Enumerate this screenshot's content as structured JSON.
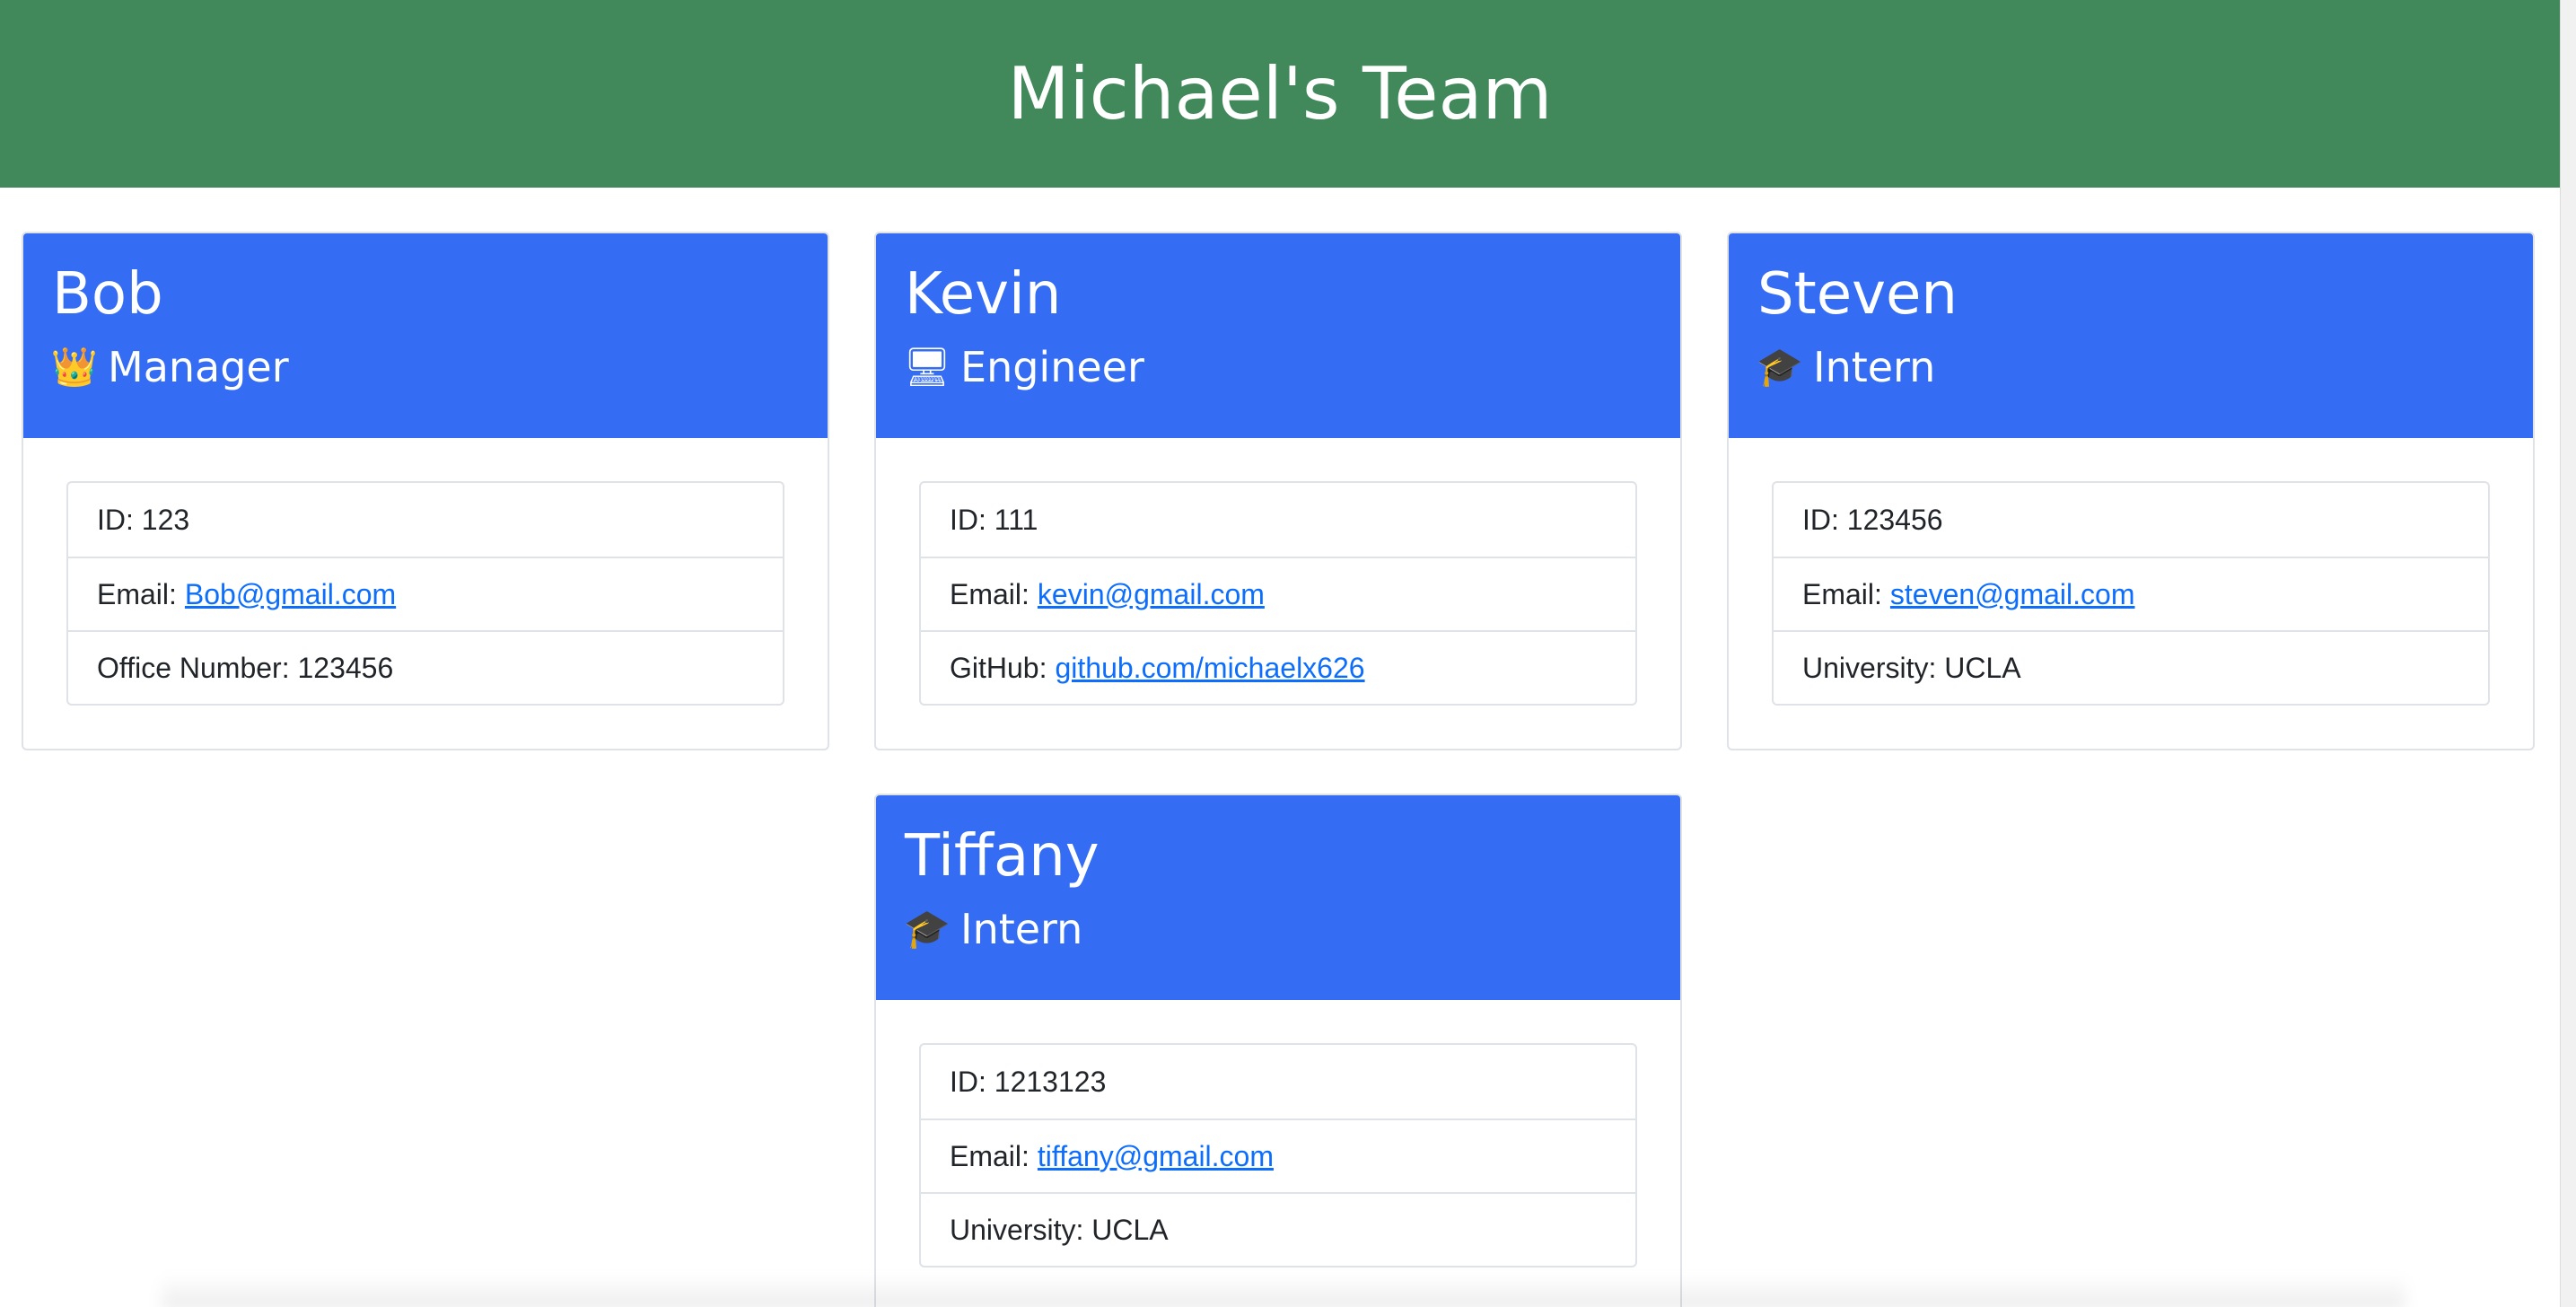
{
  "page": {
    "title": "Michael's Team"
  },
  "colors": {
    "header_bg": "#41885a",
    "card_header_bg": "#346cf4",
    "link": "#0d6efd"
  },
  "team": [
    {
      "name": "Bob",
      "role": "Manager",
      "role_icon": "crown-icon",
      "role_glyph": "👑",
      "id_label": "ID:",
      "id_value": "123",
      "email_label": "Email:",
      "email": "Bob@gmail.com",
      "extra_label": "Office Number:",
      "extra_value": "123456",
      "extra_is_link": false
    },
    {
      "name": "Kevin",
      "role": "Engineer",
      "role_icon": "computer-icon",
      "role_glyph": "🖥",
      "id_label": "ID:",
      "id_value": "111",
      "email_label": "Email:",
      "email": "kevin@gmail.com",
      "extra_label": "GitHub:",
      "extra_value": "github.com/michaelx626",
      "extra_is_link": true
    },
    {
      "name": "Steven",
      "role": "Intern",
      "role_icon": "graduation-cap-icon",
      "role_glyph": "🎓",
      "id_label": "ID:",
      "id_value": "123456",
      "email_label": "Email:",
      "email": "steven@gmail.com",
      "extra_label": "University:",
      "extra_value": "UCLA",
      "extra_is_link": false
    },
    {
      "name": "Tiffany",
      "role": "Intern",
      "role_icon": "graduation-cap-icon",
      "role_glyph": "🎓",
      "id_label": "ID:",
      "id_value": "1213123",
      "email_label": "Email:",
      "email": "tiffany@gmail.com",
      "extra_label": "University:",
      "extra_value": "UCLA",
      "extra_is_link": false
    }
  ]
}
